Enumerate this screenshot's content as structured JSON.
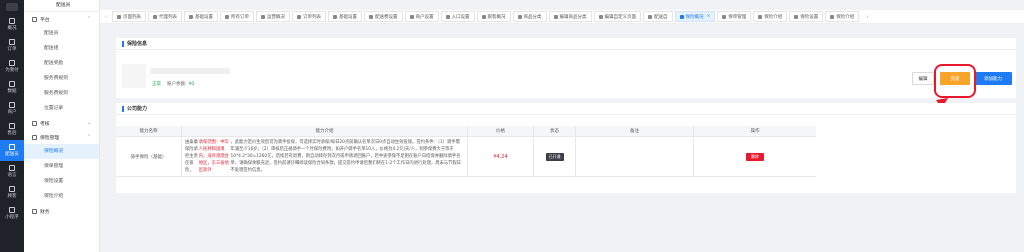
{
  "sidebar_icons": [
    {
      "label": "概况",
      "icon": "home-icon"
    },
    {
      "label": "订单",
      "icon": "order-icon"
    },
    {
      "label": "为我付",
      "icon": "pay-icon"
    },
    {
      "label": "数据",
      "icon": "data-icon"
    },
    {
      "label": "商户",
      "icon": "shop-icon"
    },
    {
      "label": "售后",
      "icon": "aftersale-icon"
    },
    {
      "label": "配送员",
      "icon": "courier-icon"
    },
    {
      "label": "语言",
      "icon": "language-icon"
    },
    {
      "label": "顾客",
      "icon": "customer-icon"
    },
    {
      "label": "小程序",
      "icon": "miniapp-icon"
    }
  ],
  "menu": {
    "header": "配送员",
    "group_platform": "平台",
    "platform_items": [
      "配送员",
      "配送组",
      "配送奖励",
      "服务费规则",
      "服务费规则",
      "位置记录"
    ],
    "group_assess": "考核",
    "group_insurance": "保险管理",
    "insurance_items": [
      "保险概况",
      "保单管理",
      "保险设置",
      "保险介绍"
    ],
    "group_finance": "财务"
  },
  "tabs": [
    "页面列表",
    "代理列表",
    "基础设置",
    "所有订单",
    "运营概况",
    "订单列表",
    "基础设置",
    "配送费设置",
    "商户设置",
    "入口设置",
    "跟客概况",
    "商品分类",
    "编辑商品分类",
    "编辑自定义页面",
    "配送自",
    "保险概况",
    "保单管理",
    "保险介绍",
    "保险设置",
    "保险介绍"
  ],
  "active_tab": "保险概况",
  "insurance_info": {
    "title": "保险信息",
    "status": "正常",
    "account_label": "账户余额:",
    "account_value": "¥0",
    "edit": "编辑",
    "recharge": "充值",
    "add_capacity": "添加能力"
  },
  "company": {
    "title": "公司能力",
    "headers": [
      "能力名称",
      "能力介绍",
      "价格",
      "状态",
      "备注",
      "操作"
    ],
    "row": {
      "name": "骑手保险（基础）",
      "desc_pre": "由泰康保险承担主责任保险，",
      "desc_red": "承保范围：中华人民共和国境内，海外港澳台地区，东三省地区除外",
      "desc_post": "，此能力定价生效后可为骑手投保，可选择实时承保/每日20点前确认名单次日0点自动生效投保。签约条件：（1）骑手需年满至少16岁；（2）审核后正规骑手一个月保险费用，如开户骑手名单10人，价格为4.2元/天/人，则参保费大于等于10*4.2*30=1260元，后续若有退费，则自动转存到次月或申请退回账户，若中途参保不足则在账户日结保并删除骑手名单，请确保余额充足。签约前请仔细阅读保险合同条款，提交签约申请后我们将在1-2个工作日内进行处理，周末与节假日不处理签约信息。",
      "price": "¥4.24",
      "status": "已开通",
      "note": "",
      "action": "删除"
    }
  }
}
